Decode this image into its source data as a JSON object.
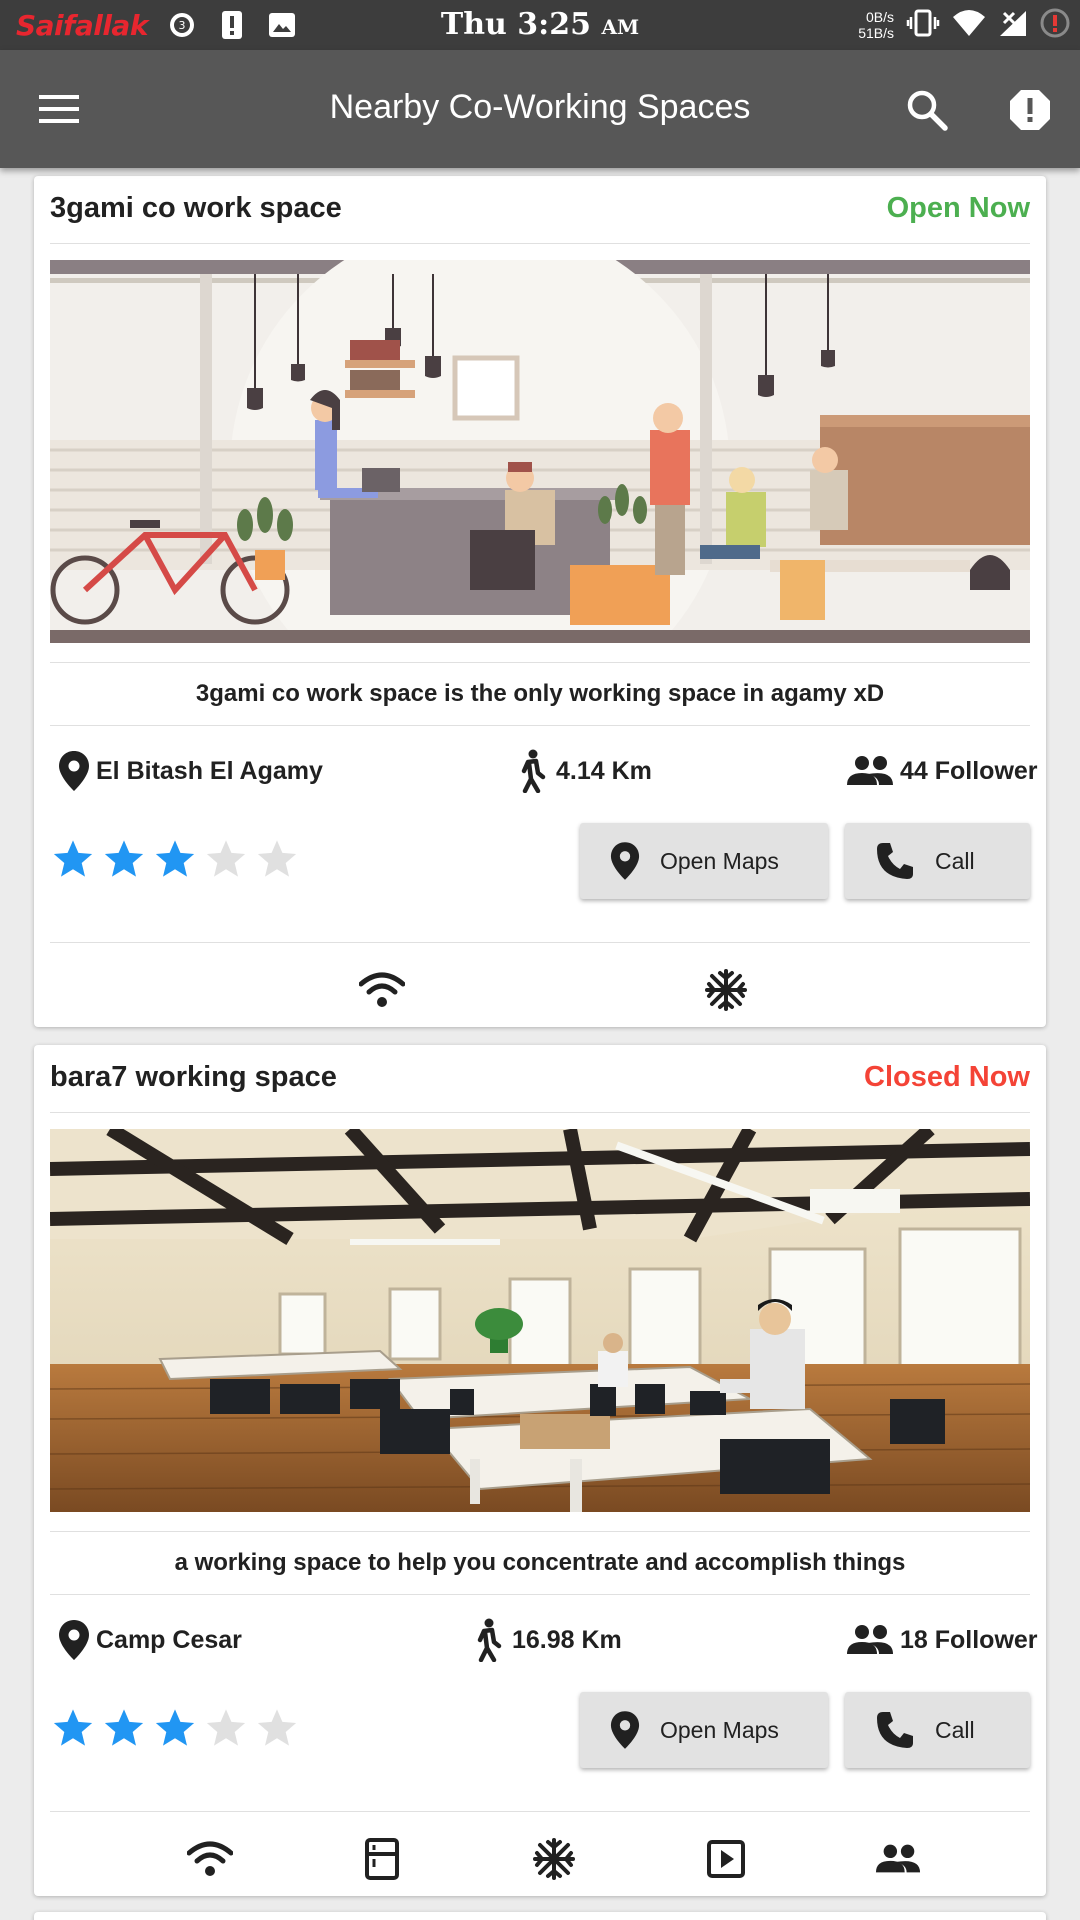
{
  "status_bar": {
    "brand": "Saifallak",
    "notif_count": "3",
    "time": "Thu 3:25",
    "ampm": "AM",
    "net_up": "0B/s",
    "net_down": "51B/s"
  },
  "app_bar": {
    "title": "Nearby Co-Working Spaces",
    "icons": [
      "menu-icon",
      "search-icon",
      "alert-icon"
    ]
  },
  "spaces": [
    {
      "name": "3gami co work space",
      "status": "Open Now",
      "status_color": "#4caf50",
      "description": "3gami co work space is the only working space in agamy xD",
      "location": "El Bitash El Agamy",
      "distance": "4.14 Km",
      "followers": "44 Follower",
      "rating": 3,
      "max_rating": 5,
      "maps_label": "Open Maps",
      "call_label": "Call",
      "amenities": [
        "wifi-icon",
        "air-conditioning-icon"
      ]
    },
    {
      "name": "bara7 working space",
      "status": "Closed Now",
      "status_color": "#f44336",
      "description": "a working space to help you concentrate and accomplish things",
      "location": "Camp Cesar",
      "distance": "16.98 Km",
      "followers": "18 Follower",
      "rating": 3,
      "max_rating": 5,
      "maps_label": "Open Maps",
      "call_label": "Call",
      "amenities": [
        "wifi-icon",
        "fridge-icon",
        "air-conditioning-icon",
        "projector-icon",
        "meeting-room-icon"
      ]
    }
  ],
  "colors": {
    "star_filled": "#2196f3",
    "star_empty": "#e0e0e0",
    "app_bar": "#575757",
    "status_bar": "#3d3d3d"
  }
}
